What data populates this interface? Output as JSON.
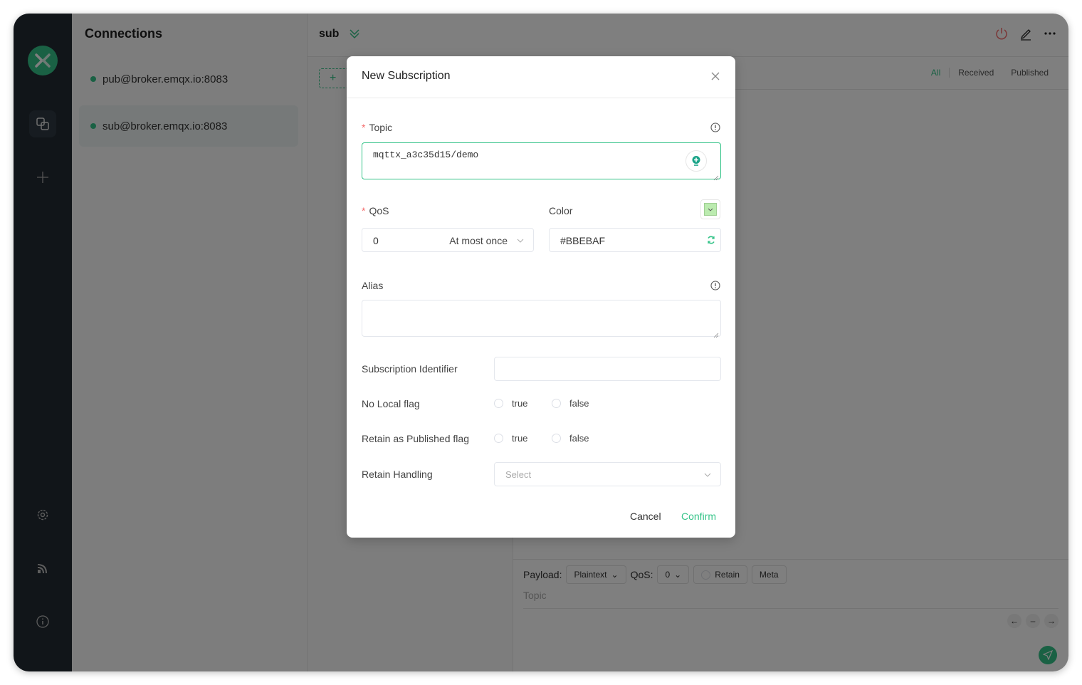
{
  "colors": {
    "accent": "#34c388",
    "danger": "#f56c6c",
    "selected_subscription_color": "#BBEBAF"
  },
  "nav": {
    "items": [
      {
        "icon": "logo-icon"
      },
      {
        "icon": "connections-icon",
        "active": true
      },
      {
        "icon": "plus-icon"
      },
      {
        "icon": "gear-icon"
      },
      {
        "icon": "feed-icon"
      },
      {
        "icon": "info-icon"
      }
    ]
  },
  "connections": {
    "title": "Connections",
    "items": [
      {
        "label": "pub@broker.emqx.io:8083",
        "status": "connected",
        "active": false
      },
      {
        "label": "sub@broker.emqx.io:8083",
        "status": "connected",
        "active": true
      }
    ]
  },
  "main": {
    "title": "sub",
    "add_subscription_label": "+",
    "tabs": [
      {
        "label": "All",
        "active": true
      },
      {
        "label": "Received",
        "active": false
      },
      {
        "label": "Published",
        "active": false
      }
    ],
    "composer": {
      "payload_label": "Payload:",
      "payload_format": "Plaintext",
      "qos_label": "QoS:",
      "qos_value": "0",
      "retain_label": "Retain",
      "meta_label": "Meta",
      "topic_placeholder": "Topic"
    }
  },
  "dialog": {
    "title": "New Subscription",
    "topic": {
      "label": "Topic",
      "required": true,
      "value": "mqttx_a3c35d15/demo"
    },
    "qos": {
      "label": "QoS",
      "required": true,
      "value": "0",
      "value_desc": "At most once"
    },
    "color": {
      "label": "Color",
      "value": "#BBEBAF"
    },
    "alias": {
      "label": "Alias",
      "value": ""
    },
    "subscription_identifier": {
      "label": "Subscription Identifier",
      "value": ""
    },
    "no_local_flag": {
      "label": "No Local flag",
      "options": [
        "true",
        "false"
      ]
    },
    "retain_as_published_flag": {
      "label": "Retain as Published flag",
      "options": [
        "true",
        "false"
      ]
    },
    "retain_handling": {
      "label": "Retain Handling",
      "placeholder": "Select"
    },
    "cancel_label": "Cancel",
    "confirm_label": "Confirm"
  }
}
